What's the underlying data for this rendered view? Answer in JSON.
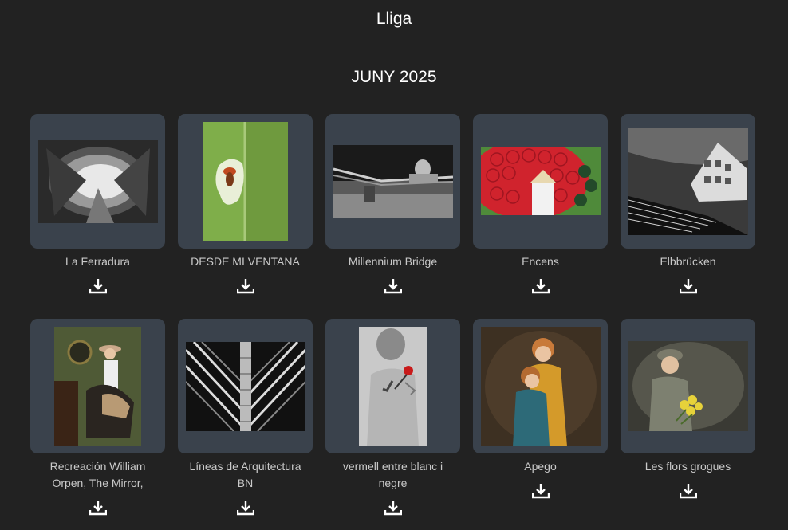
{
  "header": {
    "title": "Lliga"
  },
  "month": {
    "title": "JUNY 2025"
  },
  "download_icon": "download-icon",
  "photos": [
    {
      "title": "La Ferradura"
    },
    {
      "title": "DESDE MI VENTANA"
    },
    {
      "title": "Millennium Bridge"
    },
    {
      "title": "Encens"
    },
    {
      "title": "Elbbrücken"
    },
    {
      "title": "Recreación William Orpen, The Mirror,"
    },
    {
      "title": "Líneas de Arquitectura BN"
    },
    {
      "title": "vermell entre blanc i negre"
    },
    {
      "title": "Apego"
    },
    {
      "title": "Les flors grogues"
    }
  ]
}
